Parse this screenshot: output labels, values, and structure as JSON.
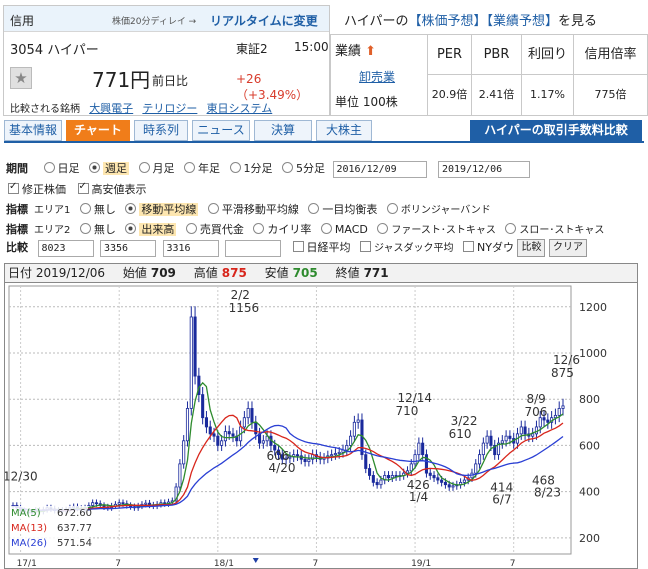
{
  "header": {
    "category": "信用",
    "delay_note": "株価20分ディレイ →",
    "realtime_link": "リアルタイムに変更",
    "code_name": "3054 ハイパー",
    "market": "東証2",
    "time": "15:00",
    "price": "771円",
    "prev_label": "前日比",
    "change": "+26 （+3.49%）",
    "compare_label": "比較される銘柄",
    "compare_links": [
      "大興電子",
      "テリロジー",
      "東日システム"
    ]
  },
  "forecast": {
    "prefix": "ハイパーの",
    "stock_forecast": "【株価予想】",
    "earnings_forecast": "【業績予想】",
    "suffix": "を見る"
  },
  "metrics": {
    "gyoseki_label": "業績",
    "gyoseki_link": "卸売業",
    "unit": "単位 100株",
    "columns": [
      {
        "label": "PER",
        "value": "20.9倍"
      },
      {
        "label": "PBR",
        "value": "2.41倍"
      },
      {
        "label": "利回り",
        "value": "1.17%"
      },
      {
        "label": "信用倍率",
        "value": "775倍"
      }
    ]
  },
  "tabs": [
    "基本情報",
    "チャート",
    "時系列",
    "ニュース",
    "決算",
    "大株主"
  ],
  "active_tab": "チャート",
  "tab_ext": "ハイパーの取引手数料比較",
  "controls": {
    "period_label": "期間",
    "periods": [
      "日足",
      "週足",
      "月足",
      "年足",
      "1分足",
      "5分足"
    ],
    "selected_period": "週足",
    "date_from": "2016/12/09",
    "date_to": "2019/12/06",
    "adj_price": "修正株価",
    "high_low": "高安値表示",
    "ind1_label": "指標",
    "ind1_area": "エリア1",
    "ind1_opts": [
      "無し",
      "移動平均線",
      "平滑移動平均線",
      "一目均衡表",
      "ボリンジャーバンド"
    ],
    "ind1_selected": "移動平均線",
    "ind2_label": "指標",
    "ind2_area": "エリア2",
    "ind2_opts": [
      "無し",
      "出来高",
      "売買代金",
      "カイリ率",
      "MACD",
      "ファースト･ストキャス",
      "スロー･ストキャス"
    ],
    "ind2_selected": "出来高",
    "cmp_label": "比較",
    "cmp_codes": [
      "8023",
      "3356",
      "3316",
      ""
    ],
    "cmp_checks": [
      "日経平均",
      "ジャスダック平均",
      "NYダウ"
    ],
    "cmp_btn": "比較",
    "clear_btn": "クリア"
  },
  "chart_info": {
    "date_label": "日付",
    "date": "2019/12/06",
    "open_label": "始値",
    "open": "709",
    "high_label": "高値",
    "high": "875",
    "low_label": "安値",
    "low": "705",
    "close_label": "終値",
    "close": "771"
  },
  "chart_data": {
    "type": "candlestick",
    "y_ticks": [
      200,
      400,
      600,
      800,
      1000,
      1200
    ],
    "ylim": [
      130,
      1290
    ],
    "x_ticks": [
      "17/1",
      "7",
      "18/1",
      "7",
      "19/1",
      "7"
    ],
    "ma_legend": [
      {
        "name": "MA(5)",
        "value": "672.60",
        "color": "#2e8b2e"
      },
      {
        "name": "MA(13)",
        "value": "637.77",
        "color": "#d8261c"
      },
      {
        "name": "MA(26)",
        "value": "571.54",
        "color": "#2a3fd4"
      }
    ],
    "annotations": [
      {
        "text": "12/30",
        "x": 0,
        "y": 370,
        "label": "12/30"
      },
      {
        "text": "2/2",
        "label": "2/2",
        "x": 60,
        "y": 1156,
        "value": "1156"
      },
      {
        "text": "4/20",
        "label": "4/20",
        "x": 70,
        "y": 545,
        "value": "606"
      },
      {
        "text": "12/14",
        "label": "12/14",
        "x": 104,
        "y": 710,
        "value": "710"
      },
      {
        "text": "1/4",
        "label": "1/4",
        "x": 107,
        "y": 420,
        "value": "426"
      },
      {
        "text": "3/22",
        "label": "3/22",
        "x": 118,
        "y": 610,
        "value": "610"
      },
      {
        "text": "6/7",
        "label": "6/7",
        "x": 129,
        "y": 410,
        "value": "414"
      },
      {
        "text": "8/9",
        "label": "8/9",
        "x": 138,
        "y": 706,
        "value": "706"
      },
      {
        "text": "8/23",
        "label": "8/23",
        "x": 140,
        "y": 440,
        "value": "468"
      },
      {
        "text": "12/6",
        "label": "12/6",
        "x": 155,
        "y": 875,
        "value": "875"
      }
    ],
    "close": [
      340,
      330,
      318,
      312,
      308,
      312,
      320,
      314,
      322,
      330,
      325,
      318,
      320,
      315,
      322,
      330,
      335,
      328,
      322,
      330,
      340,
      352,
      348,
      340,
      334,
      330,
      338,
      345,
      352,
      348,
      340,
      335,
      330,
      338,
      345,
      350,
      342,
      338,
      345,
      352,
      348,
      355,
      360,
      420,
      520,
      620,
      760,
      1156,
      900,
      820,
      720,
      680,
      650,
      640,
      600,
      620,
      660,
      650,
      640,
      620,
      680,
      720,
      760,
      700,
      650,
      610,
      620,
      640,
      600,
      580,
      560,
      540,
      545,
      550,
      560,
      555,
      540,
      530,
      540,
      560,
      550,
      540,
      545,
      555,
      560,
      565,
      570,
      580,
      600,
      640,
      700,
      710,
      560,
      500,
      470,
      440,
      430,
      450,
      470,
      460,
      470,
      465,
      470,
      480,
      490,
      520,
      560,
      610,
      560,
      480,
      470,
      460,
      450,
      440,
      430,
      420,
      425,
      430,
      440,
      450,
      460,
      480,
      520,
      560,
      610,
      640,
      600,
      560,
      610,
      620,
      640,
      630,
      610,
      650,
      680,
      650,
      640,
      650,
      680,
      720,
      710,
      700,
      720,
      730,
      760,
      771
    ]
  }
}
